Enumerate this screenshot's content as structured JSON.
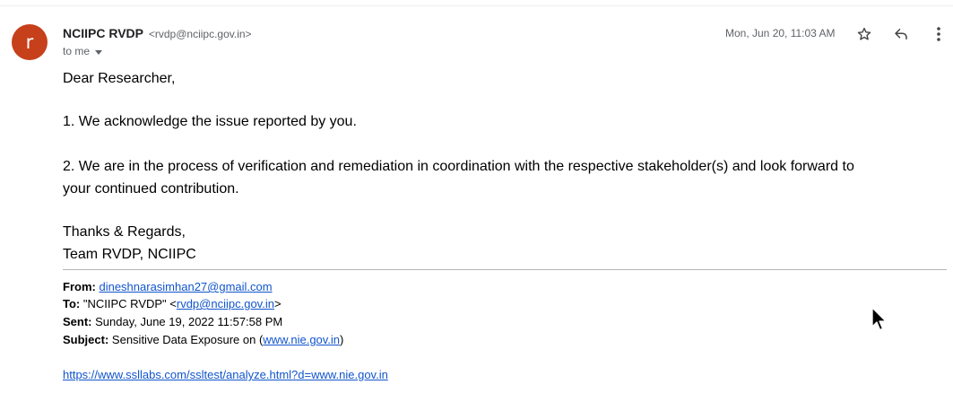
{
  "sender": {
    "avatar_letter": "r",
    "name": "NCIIPC RVDP",
    "email": "<rvdp@nciipc.gov.in>",
    "to_label": "to me",
    "date": "Mon, Jun 20, 11:03 AM"
  },
  "icons": {
    "star": "star-icon",
    "reply": "reply-icon",
    "more": "more-vert-icon"
  },
  "body": {
    "greeting": "Dear Researcher,",
    "line1": "1. We acknowledge the issue reported by you.",
    "line2a": "2. We are in the process of verification and remediation in coordination with the respective stakeholder(s) and look forward to",
    "line2b": "your continued contribution.",
    "thanks": "Thanks & Regards,",
    "signature": "Team RVDP, NCIIPC"
  },
  "quoted": {
    "from_label": "From:",
    "from_value": "dineshnarasimhan27@gmail.com",
    "to_label": "To:",
    "to_prefix": "\"NCIIPC RVDP\" <",
    "to_email": "rvdp@nciipc.gov.in",
    "to_suffix": ">",
    "sent_label": "Sent:",
    "sent_value": "Sunday, June 19, 2022 11:57:58 PM",
    "subject_label": "Subject:",
    "subject_prefix": "Sensitive Data Exposure on (",
    "subject_link": "www.nie.gov.in",
    "subject_suffix": ")",
    "url": "https://www.ssllabs.com/ssltest/analyze.html?d=www.nie.gov.in"
  },
  "colors": {
    "avatar": "#c6401b",
    "link": "#1155cc",
    "muted": "#5f6368"
  }
}
